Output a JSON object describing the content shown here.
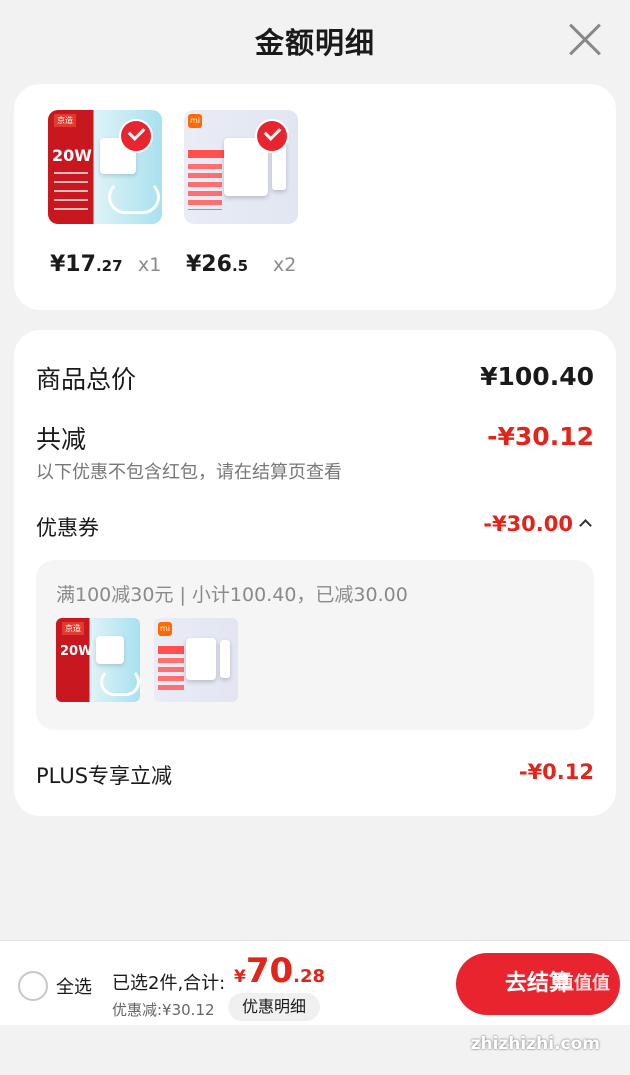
{
  "header": {
    "title": "金额明细"
  },
  "products": [
    {
      "price_int": "¥17",
      "price_dec": ".27",
      "qty": "x1",
      "thumb_tag": "京造",
      "thumb_big": "20W"
    },
    {
      "price_int": "¥26",
      "price_dec": ".5",
      "qty": "x2",
      "thumb_tag": "mi"
    }
  ],
  "summary": {
    "total_label": "商品总价",
    "total_value": "¥100.40",
    "reduce_label": "共减",
    "reduce_value": "-¥30.12",
    "note": "以下优惠不包含红包，请在结算页查看",
    "coupon_label": "优惠券",
    "coupon_value": "-¥30.00",
    "coupon_detail": "满100减30元 | 小计100.40，已减30.00",
    "plus_label": "PLUS专享立减",
    "plus_value": "-¥0.12"
  },
  "footer": {
    "select_all": "全选",
    "count_text": "已选2件,合计:",
    "total_cur": "¥",
    "total_int": "70",
    "total_dec": ".28",
    "discount_text": "优惠减:¥30.12",
    "detail_button": "优惠明细",
    "checkout": "去结算",
    "watermark_top": "值值值",
    "watermark_bottom": "zhizhizhi.com"
  },
  "colors": {
    "accent": "#e1251b",
    "background": "#f2f2f2"
  }
}
